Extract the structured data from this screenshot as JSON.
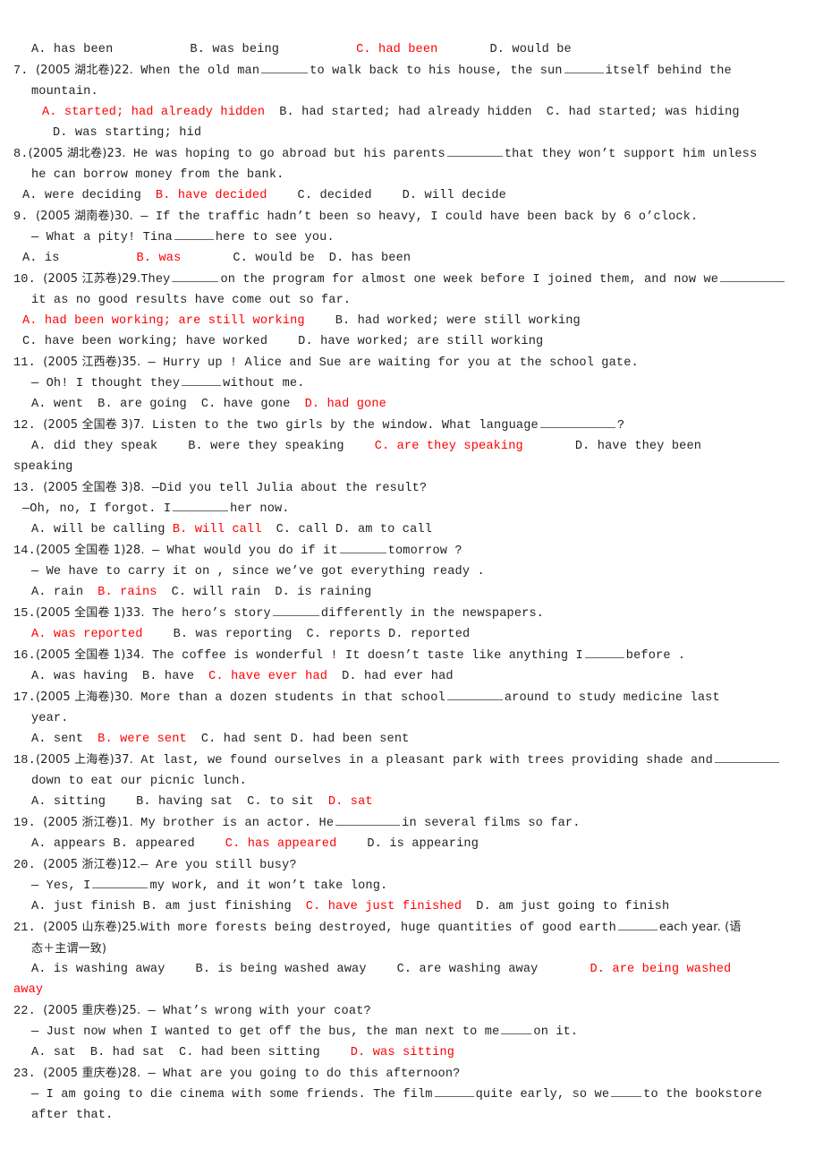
{
  "document": {
    "type": "english-grammar-multiple-choice-worksheet",
    "answer_color": "#fe0000",
    "text_color": "#231f20"
  },
  "top_options_line": {
    "a": "A. has been",
    "b": "B. was being",
    "c": "C. had been",
    "c_is_answer": true,
    "d": "D. would be"
  },
  "questions": [
    {
      "number": "7.",
      "source": "(2005 湖北卷)22.",
      "stem_part1": "When the old man",
      "stem_part2": "to walk back to his house, the sun",
      "stem_part3": "itself behind the",
      "stem_cont": "mountain.",
      "opt_a": "A. started; had already hidden",
      "opt_b": "B. had started; had already hidden",
      "opt_c": "C. had started; was hiding",
      "opt_d": "D. was starting; hid",
      "answer": "A"
    },
    {
      "number": "8.",
      "source": "(2005 湖北卷)23.",
      "stem_part1": "He was hoping to go abroad but his parents",
      "stem_part2": "that they won’t support him unless",
      "stem_cont": "he can borrow money from the bank.",
      "opt_a": "A. were deciding",
      "opt_b": "B. have decided",
      "opt_c": "C. decided",
      "opt_d": "D. will decide",
      "answer": "B"
    },
    {
      "number": "9.",
      "source": "(2005 湖南卷)30.",
      "stem_part1": "— If the traffic hadn’t been so heavy, I could have been back by 6 o’clock.",
      "stem_line2_part1": "— What a pity! Tina",
      "stem_line2_part2": "here to see you.",
      "opt_a": "A. is",
      "opt_b": "B. was",
      "opt_c": "C. would be",
      "opt_d": "D. has been",
      "answer": "B"
    },
    {
      "number": "10.",
      "source": "(2005 江苏卷)29.",
      "stem_part1": "They",
      "stem_part2": "on the program for almost one week before I joined them, and now we",
      "stem_cont": "it as no good results have come out so far.",
      "opt_a": "A. had been working; are still working",
      "opt_b": "B. had worked; were still working",
      "opt_c": "C. have been working; have worked",
      "opt_d": "D. have worked; are still working",
      "answer": "A"
    },
    {
      "number": "11.",
      "source": "(2005 江西卷)35.",
      "stem_part1": "— Hurry up ! Alice and Sue are waiting for you at the school gate.",
      "stem_line2_part1": "— Oh! I thought they",
      "stem_line2_part2": "without me.",
      "opt_a": "A. went",
      "opt_b": "B. are going",
      "opt_c": "C. have gone",
      "opt_d": "D. had gone",
      "answer": "D"
    },
    {
      "number": "12.",
      "source": "(2005 全国卷 3)7.",
      "stem_part1": "Listen to the two girls by the window. What language",
      "stem_part2": "?",
      "opt_a": "A. did they speak",
      "opt_b": "B. were they speaking",
      "opt_c": "C. are they speaking",
      "opt_d": "D. have they been",
      "opt_d_wrap": "speaking",
      "answer": "C"
    },
    {
      "number": "13.",
      "source": "(2005 全国卷 3)8.",
      "stem_part1": "—Did you tell Julia about the result?",
      "stem_line2_part1": "—Oh, no, I forgot. I",
      "stem_line2_part2": "her now.",
      "opt_a": "A. will be calling",
      "opt_b": "B. will call",
      "opt_c": "C. call",
      "opt_d": "D. am to call",
      "answer": "B"
    },
    {
      "number": "14.",
      "source": "(2005 全国卷 1)28.",
      "stem_part1": "— What would you do if it",
      "stem_part2": "tomorrow ?",
      "stem_line2": "— We have to carry it on , since we’ve got everything ready .",
      "opt_a": "A. rain",
      "opt_b": "B. rains",
      "opt_c": "C. will rain",
      "opt_d": "D. is raining",
      "answer": "B"
    },
    {
      "number": "15.",
      "source": "(2005 全国卷 1)33.",
      "stem_part1": "The hero’s story",
      "stem_part2": "differently in the newspapers.",
      "opt_a": "A. was reported",
      "opt_b": "B. was reporting",
      "opt_c": "C. reports",
      "opt_d": "D. reported",
      "answer": "A"
    },
    {
      "number": "16.",
      "source": "(2005 全国卷 1)34.",
      "stem_part1": "The coffee is wonderful ! It doesn’t taste like anything I",
      "stem_part2": "before .",
      "opt_a": "A. was having",
      "opt_b": "B. have",
      "opt_c": "C. have ever had",
      "opt_d": "D. had ever had",
      "answer": "C"
    },
    {
      "number": "17.",
      "source": "(2005 上海卷)30.",
      "stem_part1": "More than a dozen students in that school",
      "stem_part2": "around to study medicine last",
      "stem_cont": "year.",
      "opt_a": "A. sent",
      "opt_b": "B. were sent",
      "opt_c": "C. had sent",
      "opt_d": "D. had been sent",
      "answer": "B"
    },
    {
      "number": "18.",
      "source": "(2005 上海卷)37.",
      "stem_part1": "At last, we found ourselves in a pleasant park with trees providing shade and",
      "stem_cont": "down to eat our picnic lunch.",
      "opt_a": "A. sitting",
      "opt_b": "B. having sat",
      "opt_c": "C. to sit",
      "opt_d": "D. sat",
      "answer": "D"
    },
    {
      "number": "19.",
      "source": "(2005 浙江卷)1.",
      "stem_part1": "My brother is an actor. He",
      "stem_part2": "in several films so far.",
      "opt_a": "A. appears",
      "opt_b": "B. appeared",
      "opt_c": "C. has appeared",
      "opt_d": "D. is appearing",
      "answer": "C"
    },
    {
      "number": "20.",
      "source": "(2005 浙江卷)12.",
      "stem_part1": "— Are you still busy?",
      "stem_line2_part1": "— Yes, I",
      "stem_line2_part2": "my work, and it won’t take long.",
      "opt_a": "A. just finish",
      "opt_b": "B. am just finishing",
      "opt_c": "C. have just finished",
      "opt_d": "D. am just going to finish",
      "answer": "C"
    },
    {
      "number": "21.",
      "source": "(2005 山东卷)25.",
      "stem_part1": "With more forests being destroyed, huge quantities of good earth",
      "stem_part2": "each year. (语",
      "stem_cont": "态＋主谓一致)",
      "opt_a": "A. is washing away",
      "opt_b": "B. is being washed away",
      "opt_c": "C. are washing away",
      "opt_d": "D. are being washed",
      "opt_d_wrap": "away",
      "answer": "D"
    },
    {
      "number": "22.",
      "source": "(2005 重庆卷)25.",
      "stem_part1": "— What’s wrong with your coat?",
      "stem_line2_part1": "— Just now when I wanted to get off the bus, the man next to me",
      "stem_line2_part2": "on it.",
      "opt_a": "A. sat",
      "opt_b": "B. had sat",
      "opt_c": "C. had been sitting",
      "opt_d": "D. was sitting",
      "answer": "D"
    },
    {
      "number": "23.",
      "source": "(2005 重庆卷)28.",
      "stem_part1": "— What are you going to do this afternoon?",
      "stem_line2_part1": "— I am going to die cinema with some friends. The film",
      "stem_line2_part2": "quite early, so we",
      "stem_line2_part3": "to the bookstore",
      "stem_cont": "after that.",
      "answer": ""
    }
  ]
}
